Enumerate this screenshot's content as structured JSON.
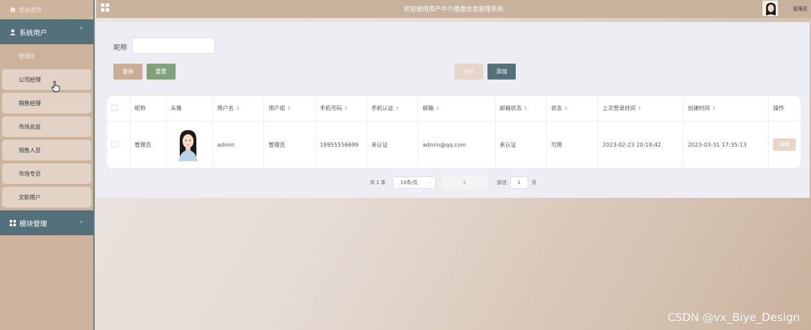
{
  "header": {
    "title": "欢迎使用房产中介楼盘信息管理系统",
    "user_name": "管理员"
  },
  "sidebar": {
    "home_label": "后台首页",
    "groups": [
      {
        "label": "系统用户",
        "expanded": true,
        "items": [
          {
            "label": "管理员",
            "active": true
          },
          {
            "label": "公司经理"
          },
          {
            "label": "销售经理"
          },
          {
            "label": "市场总监"
          },
          {
            "label": "销售人员"
          },
          {
            "label": "市场专员"
          },
          {
            "label": "文职用户"
          }
        ]
      },
      {
        "label": "模块管理",
        "expanded": false
      }
    ]
  },
  "search": {
    "label": "昵称",
    "value": "",
    "query_label": "查询",
    "reset_label": "重置"
  },
  "actions": {
    "delete_label": "删除",
    "add_label": "添加"
  },
  "table": {
    "columns": [
      "昵称",
      "头像",
      "用户名",
      "用户组",
      "手机号码",
      "手机认证",
      "邮箱",
      "邮箱状态",
      "状态",
      "上次登录时间",
      "创建时间",
      "操作"
    ],
    "rows": [
      {
        "nickname": "管理员",
        "username": "admin",
        "group": "管理员",
        "phone": "18955556699",
        "phone_verified": "未认证",
        "email": "admin@qq.com",
        "email_status": "未认证",
        "status": "可用",
        "last_login": "2023-02-23 20:18:42",
        "created": "2023-03-31 17:35:13",
        "action_label": "详情"
      }
    ]
  },
  "pagination": {
    "total_text": "共 1 条",
    "page_size": "10条/页",
    "current_page": "1",
    "goto_label": "前往",
    "goto_value": "1",
    "page_unit": "页"
  },
  "watermark": "CSDN @vx_Biye_Design",
  "colors": {
    "sidebar_group": "#54707b",
    "sidebar_bg": "#ccb39b",
    "header": "#c8b19d",
    "query_button": "#c9ae94",
    "reset_button": "#7fa27a",
    "add_button": "#54707b",
    "delete_button": "#e6d5c8"
  }
}
